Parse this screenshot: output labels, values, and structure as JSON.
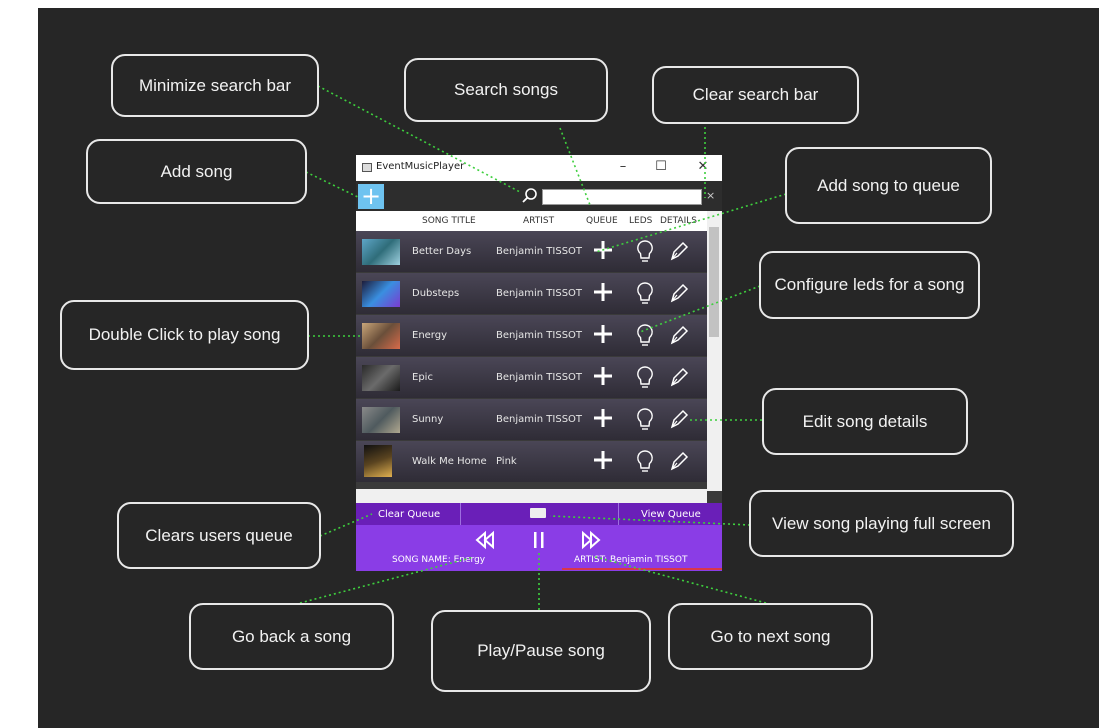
{
  "window": {
    "title": "EventMusicPlayer",
    "minimize_glyph": "–",
    "maximize_glyph": "☐",
    "close_glyph": "✕"
  },
  "toolbar": {
    "add_glyph": "+",
    "search_value": "",
    "search_clear_glyph": "×"
  },
  "columns": [
    "SONG TITLE",
    "ARTIST",
    "QUEUE",
    "LEDS",
    "DETAILS"
  ],
  "songs": [
    {
      "title": "Better Days",
      "artist": "Benjamin TISSOT"
    },
    {
      "title": "Dubsteps",
      "artist": "Benjamin TISSOT"
    },
    {
      "title": "Energy",
      "artist": "Benjamin TISSOT"
    },
    {
      "title": "Epic",
      "artist": "Benjamin TISSOT"
    },
    {
      "title": "Sunny",
      "artist": "Benjamin TISSOT"
    },
    {
      "title": "Walk Me Home",
      "artist": "Pink"
    }
  ],
  "queue_bar": {
    "clear_label": "Clear Queue",
    "view_label": "View Queue"
  },
  "player": {
    "song_name_label": "SONG NAME: Energy",
    "artist_label": "ARTIST:  Benjamin TISSOT"
  },
  "annotations": {
    "minimize_search_bar": "Minimize search bar",
    "search_songs": "Search songs",
    "clear_search_bar": "Clear search bar",
    "add_song": "Add song",
    "add_song_to_queue": "Add song to queue",
    "configure_leds": "Configure leds for a song",
    "double_click_play": "Double Click to play song",
    "edit_song_details": "Edit song details",
    "clears_users_queue": "Clears users queue",
    "view_full_screen": "View song playing full screen",
    "go_back_song": "Go back a song",
    "play_pause_song": "Play/Pause song",
    "go_next_song": "Go to next song"
  },
  "colors": {
    "background": "#262626",
    "accent_blue": "#6ec3f0",
    "queue_bar": "#6a1fb8",
    "player_bar": "#8a3de6",
    "connector": "#3ecf3e"
  },
  "icons": {
    "search": "magnifier-icon",
    "add": "plus-icon",
    "leds": "lightbulb-icon",
    "details": "pen-icon",
    "previous": "rewind-icon",
    "pause": "pause-icon",
    "next": "fast-forward-icon",
    "fullscreen": "fullscreen-icon"
  }
}
